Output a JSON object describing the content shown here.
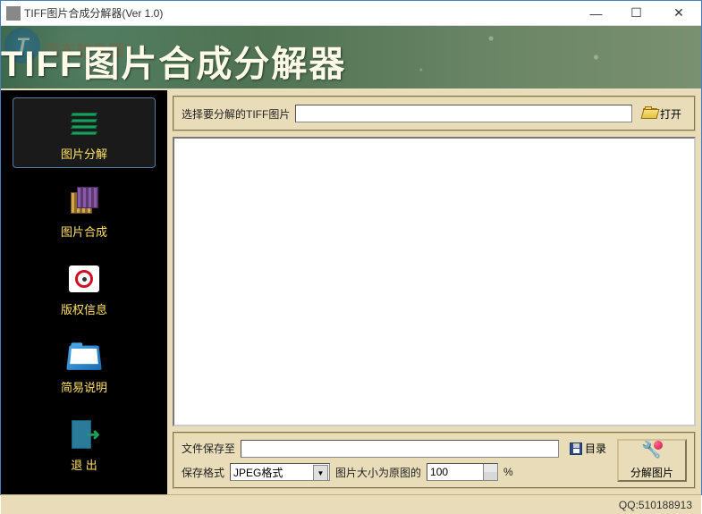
{
  "window": {
    "title": "TIFF图片合成分解器(Ver 1.0)"
  },
  "banner": {
    "watermark_letter": "T",
    "watermark_text": "河东软件园",
    "title": "TIFF图片合成分解器"
  },
  "sidebar": {
    "items": [
      {
        "label": "图片分解",
        "icon": "stack-icon",
        "active": true
      },
      {
        "label": "图片合成",
        "icon": "cube-icon",
        "active": false
      },
      {
        "label": "版权信息",
        "icon": "copyright-icon",
        "active": false
      },
      {
        "label": "简易说明",
        "icon": "folder-icon",
        "active": false
      },
      {
        "label": "退 出",
        "icon": "exit-icon",
        "active": false
      }
    ]
  },
  "main": {
    "select_label": "选择要分解的TIFF图片",
    "open_button": "打开",
    "input_path": "",
    "save_to_label": "文件保存至",
    "save_to_value": "",
    "dir_button": "目录",
    "format_label": "保存格式",
    "format_value": "JPEG格式",
    "size_label": "图片大小为原图的",
    "size_value": "100",
    "size_suffix": "%",
    "run_button": "分解图片"
  },
  "status": {
    "qq_label": "QQ:510188913"
  }
}
